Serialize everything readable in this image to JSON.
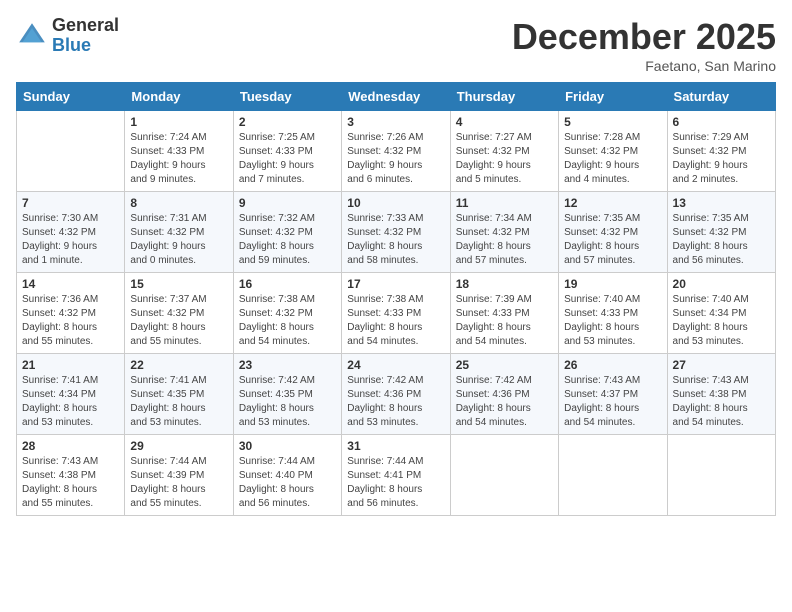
{
  "header": {
    "logo_general": "General",
    "logo_blue": "Blue",
    "month": "December 2025",
    "location": "Faetano, San Marino"
  },
  "days_of_week": [
    "Sunday",
    "Monday",
    "Tuesday",
    "Wednesday",
    "Thursday",
    "Friday",
    "Saturday"
  ],
  "weeks": [
    [
      {
        "day": "",
        "info": ""
      },
      {
        "day": "1",
        "info": "Sunrise: 7:24 AM\nSunset: 4:33 PM\nDaylight: 9 hours\nand 9 minutes."
      },
      {
        "day": "2",
        "info": "Sunrise: 7:25 AM\nSunset: 4:33 PM\nDaylight: 9 hours\nand 7 minutes."
      },
      {
        "day": "3",
        "info": "Sunrise: 7:26 AM\nSunset: 4:32 PM\nDaylight: 9 hours\nand 6 minutes."
      },
      {
        "day": "4",
        "info": "Sunrise: 7:27 AM\nSunset: 4:32 PM\nDaylight: 9 hours\nand 5 minutes."
      },
      {
        "day": "5",
        "info": "Sunrise: 7:28 AM\nSunset: 4:32 PM\nDaylight: 9 hours\nand 4 minutes."
      },
      {
        "day": "6",
        "info": "Sunrise: 7:29 AM\nSunset: 4:32 PM\nDaylight: 9 hours\nand 2 minutes."
      }
    ],
    [
      {
        "day": "7",
        "info": "Sunrise: 7:30 AM\nSunset: 4:32 PM\nDaylight: 9 hours\nand 1 minute."
      },
      {
        "day": "8",
        "info": "Sunrise: 7:31 AM\nSunset: 4:32 PM\nDaylight: 9 hours\nand 0 minutes."
      },
      {
        "day": "9",
        "info": "Sunrise: 7:32 AM\nSunset: 4:32 PM\nDaylight: 8 hours\nand 59 minutes."
      },
      {
        "day": "10",
        "info": "Sunrise: 7:33 AM\nSunset: 4:32 PM\nDaylight: 8 hours\nand 58 minutes."
      },
      {
        "day": "11",
        "info": "Sunrise: 7:34 AM\nSunset: 4:32 PM\nDaylight: 8 hours\nand 57 minutes."
      },
      {
        "day": "12",
        "info": "Sunrise: 7:35 AM\nSunset: 4:32 PM\nDaylight: 8 hours\nand 57 minutes."
      },
      {
        "day": "13",
        "info": "Sunrise: 7:35 AM\nSunset: 4:32 PM\nDaylight: 8 hours\nand 56 minutes."
      }
    ],
    [
      {
        "day": "14",
        "info": "Sunrise: 7:36 AM\nSunset: 4:32 PM\nDaylight: 8 hours\nand 55 minutes."
      },
      {
        "day": "15",
        "info": "Sunrise: 7:37 AM\nSunset: 4:32 PM\nDaylight: 8 hours\nand 55 minutes."
      },
      {
        "day": "16",
        "info": "Sunrise: 7:38 AM\nSunset: 4:32 PM\nDaylight: 8 hours\nand 54 minutes."
      },
      {
        "day": "17",
        "info": "Sunrise: 7:38 AM\nSunset: 4:33 PM\nDaylight: 8 hours\nand 54 minutes."
      },
      {
        "day": "18",
        "info": "Sunrise: 7:39 AM\nSunset: 4:33 PM\nDaylight: 8 hours\nand 54 minutes."
      },
      {
        "day": "19",
        "info": "Sunrise: 7:40 AM\nSunset: 4:33 PM\nDaylight: 8 hours\nand 53 minutes."
      },
      {
        "day": "20",
        "info": "Sunrise: 7:40 AM\nSunset: 4:34 PM\nDaylight: 8 hours\nand 53 minutes."
      }
    ],
    [
      {
        "day": "21",
        "info": "Sunrise: 7:41 AM\nSunset: 4:34 PM\nDaylight: 8 hours\nand 53 minutes."
      },
      {
        "day": "22",
        "info": "Sunrise: 7:41 AM\nSunset: 4:35 PM\nDaylight: 8 hours\nand 53 minutes."
      },
      {
        "day": "23",
        "info": "Sunrise: 7:42 AM\nSunset: 4:35 PM\nDaylight: 8 hours\nand 53 minutes."
      },
      {
        "day": "24",
        "info": "Sunrise: 7:42 AM\nSunset: 4:36 PM\nDaylight: 8 hours\nand 53 minutes."
      },
      {
        "day": "25",
        "info": "Sunrise: 7:42 AM\nSunset: 4:36 PM\nDaylight: 8 hours\nand 54 minutes."
      },
      {
        "day": "26",
        "info": "Sunrise: 7:43 AM\nSunset: 4:37 PM\nDaylight: 8 hours\nand 54 minutes."
      },
      {
        "day": "27",
        "info": "Sunrise: 7:43 AM\nSunset: 4:38 PM\nDaylight: 8 hours\nand 54 minutes."
      }
    ],
    [
      {
        "day": "28",
        "info": "Sunrise: 7:43 AM\nSunset: 4:38 PM\nDaylight: 8 hours\nand 55 minutes."
      },
      {
        "day": "29",
        "info": "Sunrise: 7:44 AM\nSunset: 4:39 PM\nDaylight: 8 hours\nand 55 minutes."
      },
      {
        "day": "30",
        "info": "Sunrise: 7:44 AM\nSunset: 4:40 PM\nDaylight: 8 hours\nand 56 minutes."
      },
      {
        "day": "31",
        "info": "Sunrise: 7:44 AM\nSunset: 4:41 PM\nDaylight: 8 hours\nand 56 minutes."
      },
      {
        "day": "",
        "info": ""
      },
      {
        "day": "",
        "info": ""
      },
      {
        "day": "",
        "info": ""
      }
    ]
  ]
}
